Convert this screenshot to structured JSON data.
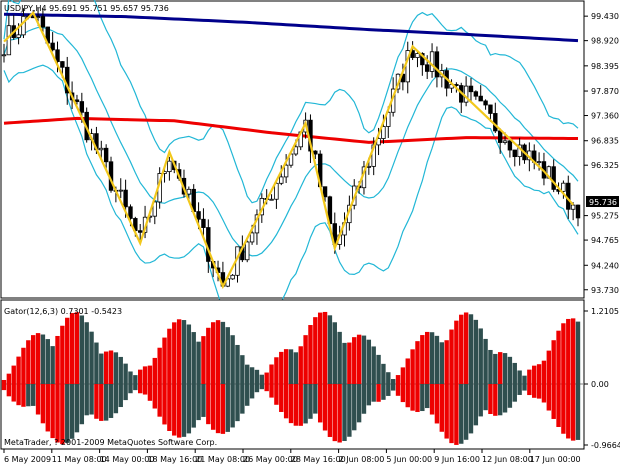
{
  "main_panel": {
    "header": "USDJPY,H4  95.691 95.751 95.657 95.736",
    "price_ticks": [
      "99.430",
      "98.920",
      "98.395",
      "97.870",
      "97.360",
      "96.835",
      "96.325",
      "95.275",
      "94.765",
      "94.240",
      "93.730"
    ],
    "current_price": "95.736"
  },
  "indicator_panel": {
    "header": "Gator(12,6,3) 0.7301 -0.5423",
    "ticks": [
      "1.2105",
      "0.00",
      "-0.9664"
    ],
    "copyright": "MetaTrader, ? 2001-2009 MetaQuotes Software Corp."
  },
  "time_axis": {
    "labels": [
      "6 May 2009",
      "11 May 08:00",
      "14 May 00:00",
      "18 May 16:00",
      "21 May 08:00",
      "26 May 00:00",
      "28 May 16:00",
      "2 Jun 08:00",
      "5 Jun 00:00",
      "9 Jun 16:00",
      "12 Jun 08:00",
      "17 Jun 00:00"
    ]
  },
  "colors": {
    "background": "#ffffff",
    "candles": "#000000",
    "ma_blue": "#00008b",
    "ma_red": "#ee0000",
    "bollinger": "#22b7d6",
    "zigzag": "#f2c81c",
    "gator_up": "#ee0000",
    "gator_down": "#2f4f4f"
  },
  "chart_data": {
    "type": "line",
    "symbol": "USDJPY",
    "timeframe": "H4",
    "ohlc_last": {
      "open": 95.691,
      "high": 95.751,
      "low": 95.657,
      "close": 95.736
    },
    "ylim": [
      93.6,
      99.6
    ],
    "zigzag": [
      {
        "x": 0,
        "y": 98.9
      },
      {
        "x": 6,
        "y": 99.5
      },
      {
        "x": 28,
        "y": 94.7
      },
      {
        "x": 34,
        "y": 96.6
      },
      {
        "x": 45,
        "y": 93.8
      },
      {
        "x": 62,
        "y": 97.2
      },
      {
        "x": 68,
        "y": 94.6
      },
      {
        "x": 84,
        "y": 98.8
      },
      {
        "x": 111,
        "y": 96.2
      },
      {
        "x": 117,
        "y": 95.5
      }
    ],
    "ma_slow": [
      {
        "x": 0,
        "y": 99.47
      },
      {
        "x": 25,
        "y": 99.42
      },
      {
        "x": 50,
        "y": 99.3
      },
      {
        "x": 75,
        "y": 99.15
      },
      {
        "x": 95,
        "y": 99.05
      },
      {
        "x": 118,
        "y": 98.92
      }
    ],
    "ma_mid": [
      {
        "x": 0,
        "y": 97.2
      },
      {
        "x": 15,
        "y": 97.3
      },
      {
        "x": 35,
        "y": 97.25
      },
      {
        "x": 55,
        "y": 97.0
      },
      {
        "x": 75,
        "y": 96.8
      },
      {
        "x": 95,
        "y": 96.9
      },
      {
        "x": 118,
        "y": 96.88
      }
    ],
    "gator": {
      "ylim": [
        -0.9664,
        1.2105
      ]
    }
  }
}
